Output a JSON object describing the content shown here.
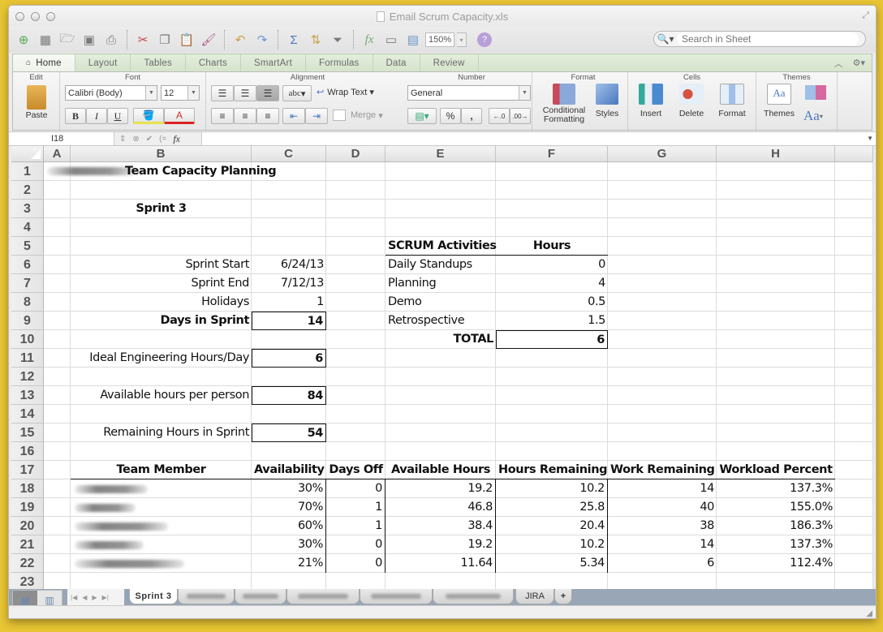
{
  "window": {
    "title": "Email Scrum Capacity.xls",
    "zoom_level": "150%",
    "search_placeholder": "Search in Sheet"
  },
  "ribbon_tabs": [
    "Home",
    "Layout",
    "Tables",
    "Charts",
    "SmartArt",
    "Formulas",
    "Data",
    "Review"
  ],
  "ribbon": {
    "groups": {
      "edit": "Edit",
      "font": "Font",
      "alignment": "Alignment",
      "number": "Number",
      "format": "Format",
      "cells": "Cells",
      "themes": "Themes"
    },
    "paste_label": "Paste",
    "font_name": "Calibri (Body)",
    "font_size": "12",
    "bold": "B",
    "italic": "I",
    "underline": "U",
    "wrap_text": "Wrap Text",
    "abc": "abc",
    "merge": "Merge",
    "number_format": "General",
    "percent": "%",
    "comma": ",",
    "conditional_formatting": "Conditional Formatting",
    "styles": "Styles",
    "insert": "Insert",
    "delete": "Delete",
    "format": "Format",
    "themes": "Themes",
    "aa": "Aa"
  },
  "formula_bar": {
    "name_box": "I18",
    "fx": "fx",
    "value": ""
  },
  "columns": [
    "A",
    "B",
    "C",
    "D",
    "E",
    "F",
    "G",
    "H"
  ],
  "rows": [
    "1",
    "2",
    "3",
    "4",
    "5",
    "6",
    "7",
    "8",
    "9",
    "10",
    "11",
    "12",
    "13",
    "14",
    "15",
    "16",
    "17",
    "18",
    "19",
    "20",
    "21",
    "22",
    "23"
  ],
  "sheet": {
    "title": "Team Capacity Planning",
    "sprint": "Sprint 3",
    "params": [
      {
        "label": "Sprint Start",
        "value": "6/24/13"
      },
      {
        "label": "Sprint End",
        "value": "7/12/13"
      },
      {
        "label": "Holidays",
        "value": "1"
      },
      {
        "label": "Days in Sprint",
        "value": "14"
      },
      {
        "label": "Ideal Engineering Hours/Day",
        "value": "6"
      },
      {
        "label": "Available hours per person",
        "value": "84"
      },
      {
        "label": "Remaining Hours in Sprint",
        "value": "54"
      }
    ],
    "scrum": {
      "header_activity": "SCRUM Activities",
      "header_hours": "Hours",
      "rows": [
        {
          "activity": "Daily Standups",
          "hours": "0"
        },
        {
          "activity": "Planning",
          "hours": "4"
        },
        {
          "activity": "Demo",
          "hours": "0.5"
        },
        {
          "activity": "Retrospective",
          "hours": "1.5"
        }
      ],
      "total_label": "TOTAL",
      "total_value": "6"
    },
    "team": {
      "headers": [
        "Team Member",
        "Availability",
        "Days Off",
        "Available Hours",
        "Hours Remaining",
        "Work Remaining",
        "Workload Percent"
      ],
      "rows": [
        {
          "member": "[redacted]",
          "availability": "30%",
          "days_off": "0",
          "available_hours": "19.2",
          "hours_remaining": "10.2",
          "work_remaining": "14",
          "workload": "137.3%"
        },
        {
          "member": "[redacted]",
          "availability": "70%",
          "days_off": "1",
          "available_hours": "46.8",
          "hours_remaining": "25.8",
          "work_remaining": "40",
          "workload": "155.0%"
        },
        {
          "member": "[redacted]",
          "availability": "60%",
          "days_off": "1",
          "available_hours": "38.4",
          "hours_remaining": "20.4",
          "work_remaining": "38",
          "workload": "186.3%"
        },
        {
          "member": "[redacted]",
          "availability": "30%",
          "days_off": "0",
          "available_hours": "19.2",
          "hours_remaining": "10.2",
          "work_remaining": "14",
          "workload": "137.3%"
        },
        {
          "member": "[redacted]",
          "availability": "21%",
          "days_off": "0",
          "available_hours": "11.64",
          "hours_remaining": "5.34",
          "work_remaining": "6",
          "workload": "112.4%"
        }
      ]
    }
  },
  "sheet_tabs": {
    "active": "Sprint 3",
    "last": "JIRA",
    "add": "+"
  }
}
